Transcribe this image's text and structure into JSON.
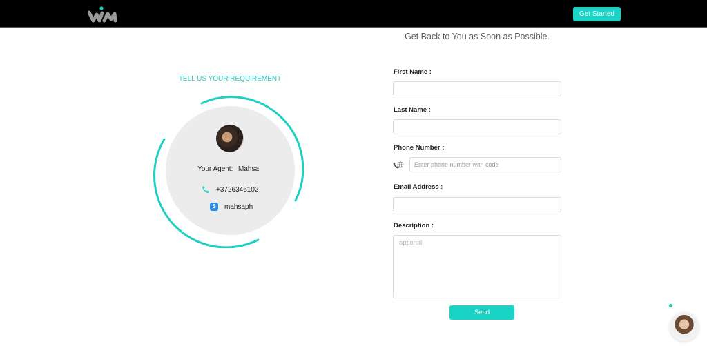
{
  "header": {
    "logo_alt": "wim logo",
    "get_started_label": "Get Started",
    "brand_color": "#19d3c5"
  },
  "main": {
    "subtitle": "Get Back to You as Soon as Possible.",
    "section_title": "TELL US YOUR REQUIREMENT"
  },
  "agent": {
    "label": "Your Agent:",
    "name": "Mahsa",
    "phone": "+3726346102",
    "skype": "mahsaph",
    "skype_icon_glyph": "S"
  },
  "form": {
    "first_name": {
      "label": "First Name :",
      "value": "",
      "placeholder": ""
    },
    "last_name": {
      "label": "Last Name :",
      "value": "",
      "placeholder": ""
    },
    "phone": {
      "label": "Phone Number :",
      "value": "",
      "placeholder": "Enter phone number with code"
    },
    "email": {
      "label": "Email Address :",
      "value": "",
      "placeholder": ""
    },
    "description": {
      "label": "Description :",
      "value": "",
      "placeholder": "optional"
    },
    "send_label": "Send"
  },
  "chat_widget": {
    "status_color": "#1cc9a8"
  }
}
